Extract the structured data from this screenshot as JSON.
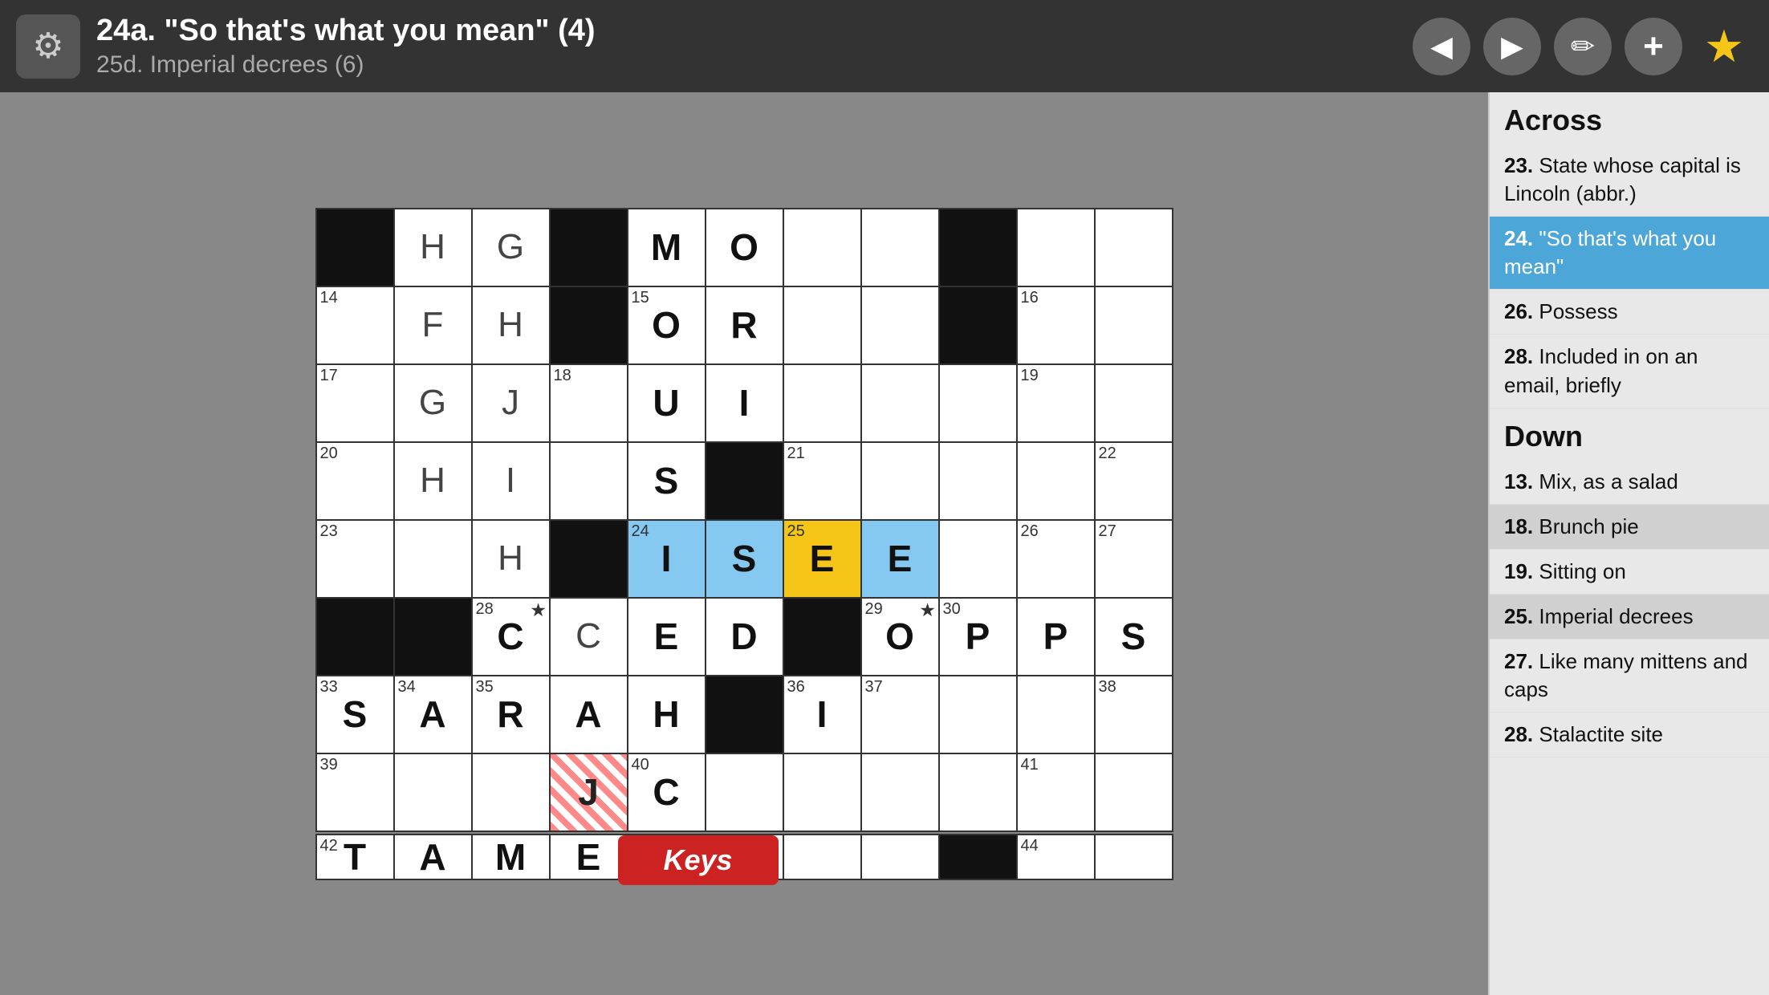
{
  "header": {
    "clue_main": "24a. \"So that's what you mean\" (4)",
    "clue_sub": "25d. Imperial decrees (6)",
    "gear_label": "⚙",
    "star_label": "★"
  },
  "clues": {
    "across_header": "Across",
    "down_header": "Down",
    "across_items": [
      {
        "number": "23.",
        "text": "State whose capital is Lincoln (abbr.)"
      },
      {
        "number": "24.",
        "text": "\"So that's what you mean\"",
        "active": true
      },
      {
        "number": "26.",
        "text": "Possess"
      },
      {
        "number": "28.",
        "text": "Included in on an email, briefly"
      }
    ],
    "down_items": [
      {
        "number": "13.",
        "text": "Mix, as a salad"
      },
      {
        "number": "18.",
        "text": "Brunch pie",
        "highlighted": true
      },
      {
        "number": "19.",
        "text": "Sitting on"
      },
      {
        "number": "25.",
        "text": "Imperial decrees",
        "highlighted": true
      },
      {
        "number": "27.",
        "text": "Like many mittens and caps"
      },
      {
        "number": "28.",
        "text": "Stalactite site"
      }
    ]
  },
  "keys_button": "Keys",
  "grid": {
    "rows": 8,
    "cols": 11
  }
}
